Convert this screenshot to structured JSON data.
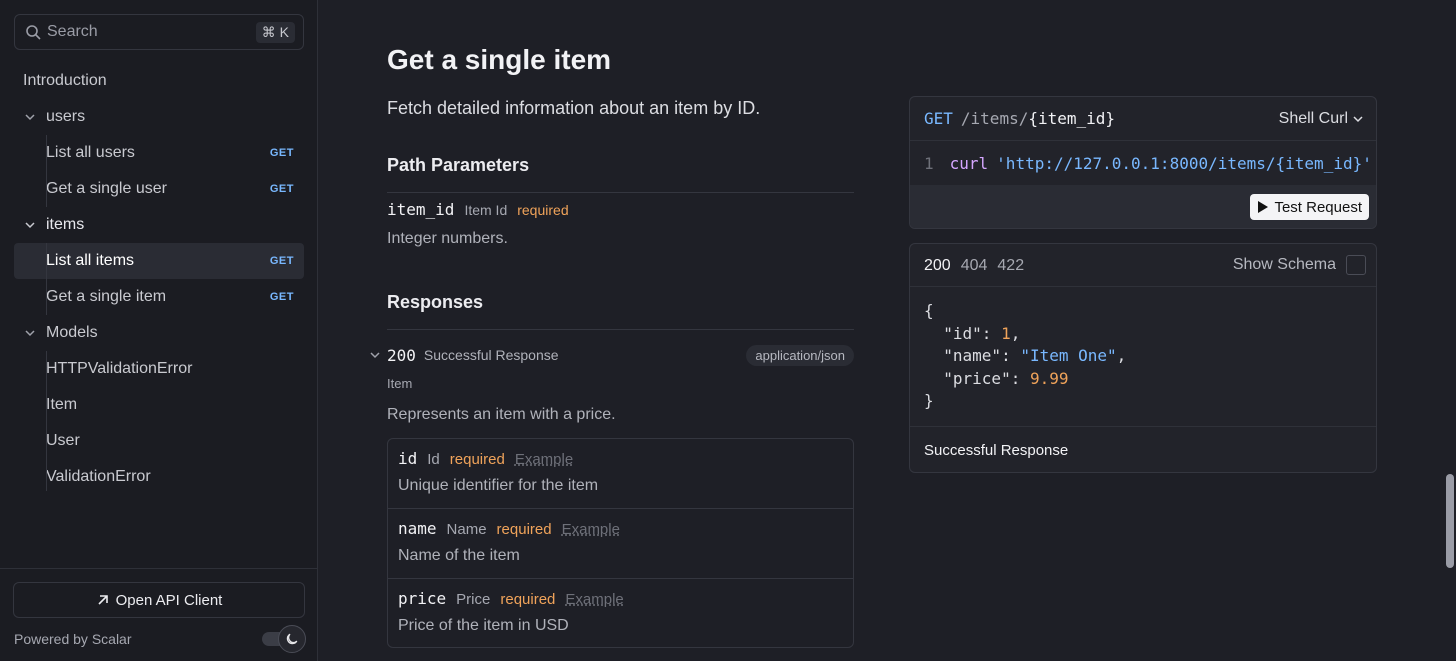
{
  "sidebar": {
    "search": {
      "placeholder": "Search",
      "shortcut": "⌘ K"
    },
    "intro": "Introduction",
    "groups": [
      {
        "label": "users",
        "items": [
          {
            "label": "List all users",
            "method": "GET"
          },
          {
            "label": "Get a single user",
            "method": "GET"
          }
        ]
      },
      {
        "label": "items",
        "items": [
          {
            "label": "List all items",
            "method": "GET"
          },
          {
            "label": "Get a single item",
            "method": "GET"
          }
        ]
      },
      {
        "label": "Models",
        "items": [
          {
            "label": "HTTPValidationError"
          },
          {
            "label": "Item"
          },
          {
            "label": "User"
          },
          {
            "label": "ValidationError"
          }
        ]
      }
    ],
    "open_client": "Open API Client",
    "powered_by": "Powered by Scalar"
  },
  "main": {
    "title": "Get a single item",
    "description": "Fetch detailed information about an item by ID.",
    "path_params_heading": "Path Parameters",
    "param": {
      "name": "item_id",
      "type": "Item Id",
      "required": "required",
      "description": "Integer numbers."
    },
    "responses_heading": "Responses",
    "response": {
      "code": "200",
      "description": "Successful Response",
      "content_type": "application/json",
      "model": "Item",
      "model_description": "Represents an item with a price."
    },
    "properties": [
      {
        "name": "id",
        "type": "Id",
        "required": "required",
        "example": "Example",
        "description": "Unique identifier for the item"
      },
      {
        "name": "name",
        "type": "Name",
        "required": "required",
        "example": "Example",
        "description": "Name of the item"
      },
      {
        "name": "price",
        "type": "Price",
        "required": "required",
        "example": "Example",
        "description": "Price of the item in USD"
      }
    ]
  },
  "request_panel": {
    "method": "GET",
    "path_prefix": "/items/",
    "path_param": "{item_id}",
    "language": "Shell Curl",
    "line_number": "1",
    "command": "curl",
    "url": "'http://127.0.0.1:8000/items/{item_id}'",
    "test_button": "Test Request"
  },
  "response_panel": {
    "tabs": [
      "200",
      "404",
      "422"
    ],
    "show_schema": "Show Schema",
    "json": {
      "open": "{",
      "id_key": "\"id\"",
      "id_val": "1",
      "name_key": "\"name\"",
      "name_val": "\"Item One\"",
      "price_key": "\"price\"",
      "price_val": "9.99",
      "close": "}"
    },
    "footer": "Successful Response"
  },
  "colors": {
    "accent": "#79b8ff",
    "required": "#f0a35a",
    "background": "#1e1f26"
  }
}
